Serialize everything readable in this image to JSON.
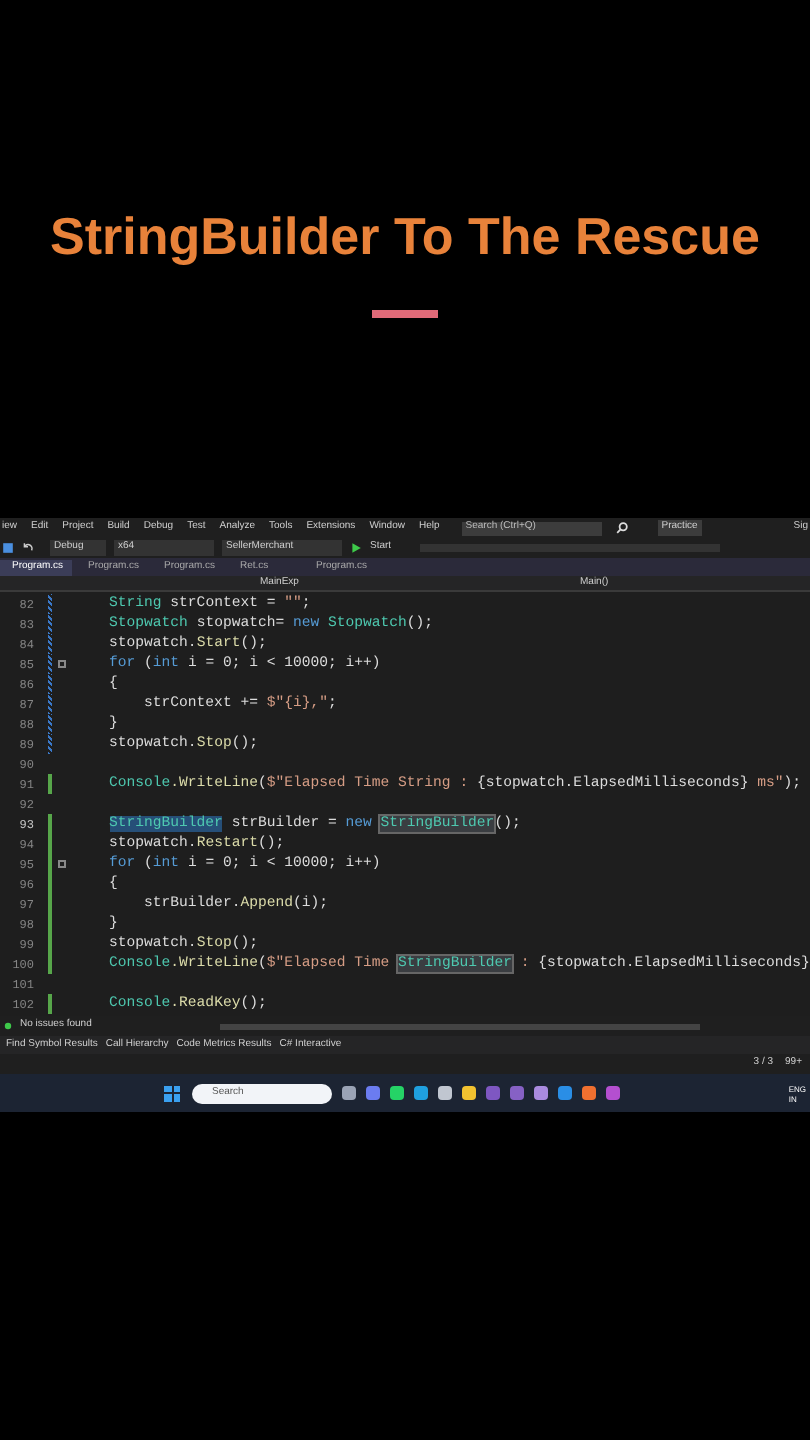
{
  "headline": "StringBuilder To The Rescue",
  "ide": {
    "menu": [
      "iew",
      "Edit",
      "Project",
      "Build",
      "Debug",
      "Test",
      "Analyze",
      "Tools",
      "Extensions",
      "Window",
      "Help"
    ],
    "search": {
      "placeholder": "Search (Ctrl+Q)"
    },
    "solution_name": "Practice",
    "account": "Sig",
    "toolbar": {
      "configuration": "Debug",
      "platform": "x64",
      "project": "SellerMerchant",
      "run": "Start"
    },
    "tabs": [
      {
        "label": "Program.cs",
        "selected": true
      },
      {
        "label": "Program.cs",
        "selected": false
      },
      {
        "label": "Program.cs",
        "selected": false
      },
      {
        "label": "Ret.cs",
        "selected": false
      },
      {
        "label": "Program.cs",
        "selected": false
      }
    ],
    "nav": {
      "type": "MainExp",
      "member": "Main()"
    },
    "lines": [
      {
        "number": "82",
        "kind": "unsaved",
        "tokens": [
          {
            "kind": "type",
            "text": "    String"
          },
          {
            "kind": "plain",
            "text": " strContext = "
          },
          {
            "kind": "string",
            "text": "\"\""
          },
          {
            "kind": "plain",
            "text": ";"
          }
        ]
      },
      {
        "number": "83",
        "kind": "unsaved",
        "tokens": [
          {
            "kind": "type",
            "text": "    Stopwatch"
          },
          {
            "kind": "plain",
            "text": " stopwatch= "
          },
          {
            "kind": "keyword",
            "text": "new "
          },
          {
            "kind": "type",
            "text": "Stopwatch"
          },
          {
            "kind": "plain",
            "text": "();"
          }
        ]
      },
      {
        "number": "84",
        "kind": "unsaved",
        "tokens": [
          {
            "kind": "plain",
            "text": "    stopwatch."
          },
          {
            "kind": "method",
            "text": "Start"
          },
          {
            "kind": "plain",
            "text": "();"
          }
        ]
      },
      {
        "number": "85",
        "kind": "unsaved",
        "fold": true,
        "tokens": [
          {
            "kind": "keyword",
            "text": "    for"
          },
          {
            "kind": "plain",
            "text": " ("
          },
          {
            "kind": "keyword",
            "text": "int"
          },
          {
            "kind": "plain",
            "text": " i = 0; i < 10000; i++)"
          }
        ]
      },
      {
        "number": "86",
        "kind": "unsaved",
        "tokens": [
          {
            "kind": "plain",
            "text": "    {"
          }
        ]
      },
      {
        "number": "87",
        "kind": "unsaved",
        "tokens": [
          {
            "kind": "plain",
            "text": "        strContext += "
          },
          {
            "kind": "string",
            "text": "$\"{i},\""
          },
          {
            "kind": "plain",
            "text": ";"
          }
        ]
      },
      {
        "number": "88",
        "kind": "unsaved",
        "tokens": [
          {
            "kind": "plain",
            "text": "    }"
          }
        ]
      },
      {
        "number": "89",
        "kind": "unsaved",
        "tokens": [
          {
            "kind": "plain",
            "text": "    stopwatch."
          },
          {
            "kind": "method",
            "text": "Stop"
          },
          {
            "kind": "plain",
            "text": "();"
          }
        ]
      },
      {
        "number": "90",
        "kind": "plain"
      },
      {
        "number": "91",
        "kind": "saved",
        "tokens": [
          {
            "kind": "type",
            "text": "    Console"
          },
          {
            "kind": "method",
            "text": ".WriteLine"
          },
          {
            "kind": "plain",
            "text": "("
          },
          {
            "kind": "string",
            "text": "$\"Elapsed Time String : "
          },
          {
            "kind": "plain",
            "text": "{stopwatch.ElapsedMilliseconds}"
          },
          {
            "kind": "string",
            "text": " ms\""
          },
          {
            "kind": "plain",
            "text": ");"
          }
        ]
      },
      {
        "number": "92",
        "kind": "plain"
      },
      {
        "number": "93",
        "kind": "saved",
        "tokens": [
          {
            "kind": "selection",
            "text": "StringBuilder"
          },
          {
            "kind": "plain",
            "text": " strBuilder = "
          },
          {
            "kind": "keyword",
            "text": "new "
          },
          {
            "kind": "reference",
            "text": "StringBuilder"
          },
          {
            "kind": "plain",
            "text": "();"
          }
        ]
      },
      {
        "number": "94",
        "kind": "saved",
        "tokens": [
          {
            "kind": "plain",
            "text": "    stopwatch."
          },
          {
            "kind": "method",
            "text": "Restart"
          },
          {
            "kind": "plain",
            "text": "();"
          }
        ]
      },
      {
        "number": "95",
        "kind": "saved",
        "fold": true,
        "tokens": [
          {
            "kind": "keyword",
            "text": "    for"
          },
          {
            "kind": "plain",
            "text": " ("
          },
          {
            "kind": "keyword",
            "text": "int"
          },
          {
            "kind": "plain",
            "text": " i = 0; i < 10000; i++)"
          }
        ]
      },
      {
        "number": "96",
        "kind": "saved",
        "tokens": [
          {
            "kind": "plain",
            "text": "    {"
          }
        ]
      },
      {
        "number": "97",
        "kind": "saved",
        "tokens": [
          {
            "kind": "plain",
            "text": "        strBuilder."
          },
          {
            "kind": "method",
            "text": "Append"
          },
          {
            "kind": "plain",
            "text": "(i);"
          }
        ]
      },
      {
        "number": "98",
        "kind": "saved",
        "tokens": [
          {
            "kind": "plain",
            "text": "    }"
          }
        ]
      },
      {
        "number": "99",
        "kind": "saved",
        "tokens": [
          {
            "kind": "plain",
            "text": "    stopwatch."
          },
          {
            "kind": "method",
            "text": "Stop"
          },
          {
            "kind": "plain",
            "text": "();"
          }
        ]
      },
      {
        "number": "100",
        "kind": "saved",
        "tokens": [
          {
            "kind": "type",
            "text": "    Console"
          },
          {
            "kind": "method",
            "text": ".WriteLine"
          },
          {
            "kind": "plain",
            "text": "("
          },
          {
            "kind": "string",
            "text": "$\"Elapsed Time "
          },
          {
            "kind": "reference",
            "text": "StringBuilder"
          },
          {
            "kind": "string",
            "text": " : "
          },
          {
            "kind": "plain",
            "text": "{stopwatch.ElapsedMilliseconds}"
          }
        ]
      },
      {
        "number": "101",
        "kind": "plain"
      },
      {
        "number": "102",
        "kind": "saved",
        "tokens": [
          {
            "kind": "type",
            "text": "    Console"
          },
          {
            "kind": "method",
            "text": ".ReadKey"
          },
          {
            "kind": "plain",
            "text": "();"
          }
        ]
      }
    ],
    "status": "No issues found",
    "tool_tabs": [
      "Find Symbol Results",
      "Call Hierarchy",
      "Code Metrics Results",
      "C# Interactive"
    ],
    "bottom": {
      "changes": "3 / 3",
      "edits": "99+"
    }
  },
  "taskbar": {
    "search": {
      "placeholder": "Search"
    },
    "apps": [
      {
        "color": "#9aa3b5"
      },
      {
        "color": "#6b7cf0"
      },
      {
        "color": "#25d366"
      },
      {
        "color": "#1fa0e0"
      },
      {
        "color": "#c0c6d0"
      },
      {
        "color": "#f2c230"
      },
      {
        "color": "#7e57c2"
      },
      {
        "color": "#8661c5"
      },
      {
        "color": "#a98be0"
      },
      {
        "color": "#2a8ee6"
      },
      {
        "color": "#f07030"
      },
      {
        "color": "#b44fd0"
      }
    ],
    "language": "ENG",
    "region": "IN"
  }
}
